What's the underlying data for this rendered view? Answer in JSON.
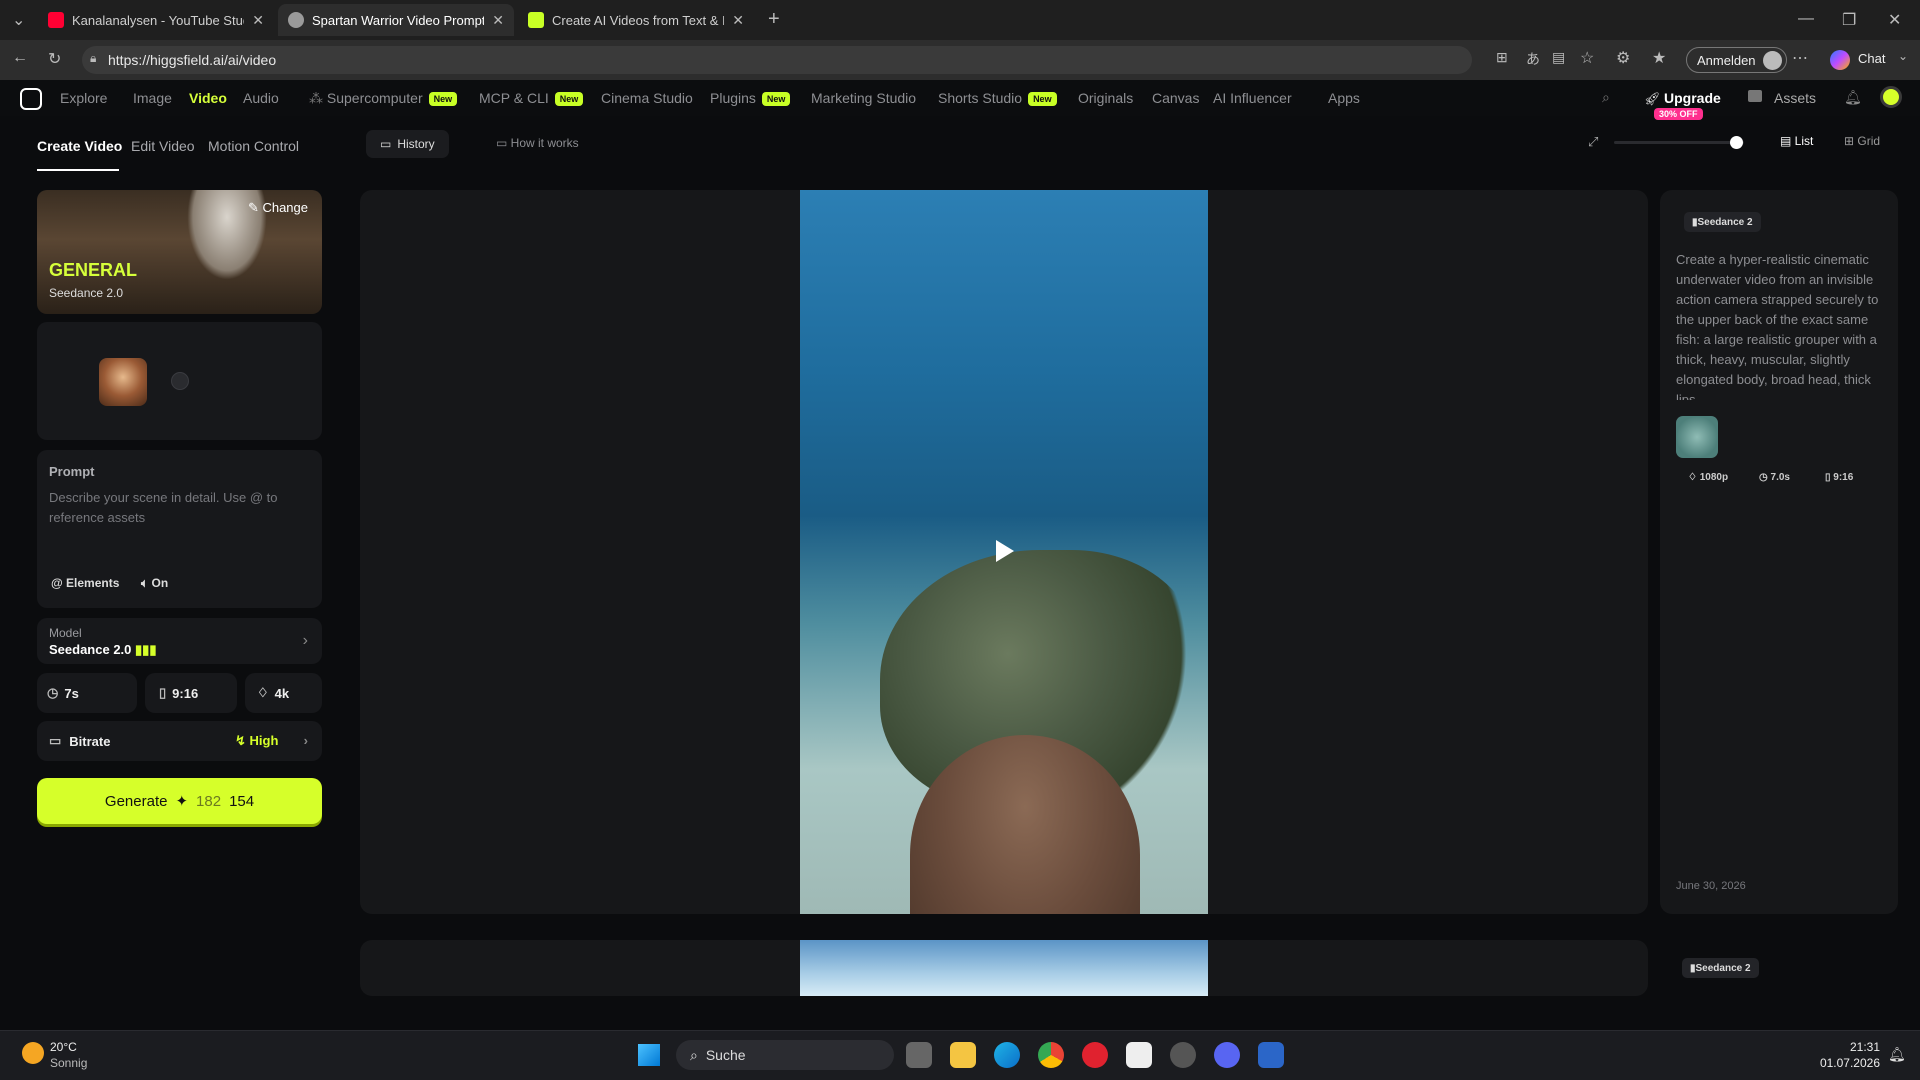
{
  "browser": {
    "tabs": [
      {
        "label": "Kanalanalysen - YouTube Studio",
        "active": false
      },
      {
        "label": "Spartan Warrior Video Prompts",
        "active": true
      },
      {
        "label": "Create AI Videos from Text & Imag",
        "active": false
      }
    ],
    "url": "https://higgsfield.ai/ai/video",
    "sign_in": "Anmelden",
    "chat": "Chat"
  },
  "nav": {
    "items": [
      "Explore",
      "Image",
      "Video",
      "Audio",
      "Supercomputer",
      "MCP & CLI",
      "Cinema Studio",
      "Plugins",
      "Marketing Studio",
      "Shorts Studio",
      "Originals",
      "Canvas",
      "AI Influencer",
      "Apps"
    ],
    "new_badge": "New",
    "upgrade": "Upgrade",
    "discount": "30% OFF",
    "assets": "Assets"
  },
  "left": {
    "tabs": [
      "Create Video",
      "Edit Video",
      "Motion Control"
    ],
    "preset": {
      "title": "GENERAL",
      "subtitle": "Seedance 2.0",
      "change": "Change"
    },
    "prompt": {
      "label": "Prompt",
      "placeholder": "Describe your scene in detail. Use @ to reference assets"
    },
    "elements": "Elements",
    "audio": "On",
    "model": {
      "label": "Model",
      "value": "Seedance 2.0"
    },
    "duration": "7s",
    "aspect": "9:16",
    "resolution": "4k",
    "bitrate": {
      "label": "Bitrate",
      "value": "High"
    },
    "generate": {
      "label": "Generate",
      "old_cost": "182",
      "cost": "154"
    }
  },
  "main": {
    "history": "History",
    "how": "How it works",
    "view_list": "List",
    "view_grid": "Grid"
  },
  "details": {
    "model": "Seedance 2",
    "prompt": "Create a hyper-realistic cinematic underwater video from an invisible action camera strapped securely to the upper back of the exact same fish: a large realistic grouper with a thick, heavy, muscular, slightly elongated body, broad head, thick lips",
    "resolution": "1080p",
    "duration": "7.0s",
    "aspect": "9:16",
    "date": "June 30, 2026",
    "model2": "Seedance 2"
  },
  "taskbar": {
    "weather_temp": "20°C",
    "weather_text": "Sonnig",
    "search": "Suche",
    "time": "21:31",
    "date": "01.07.2026"
  },
  "colors": {
    "accent": "#d6ff2a",
    "badge": "#c8ff25",
    "discount": "#ff2f8e"
  }
}
